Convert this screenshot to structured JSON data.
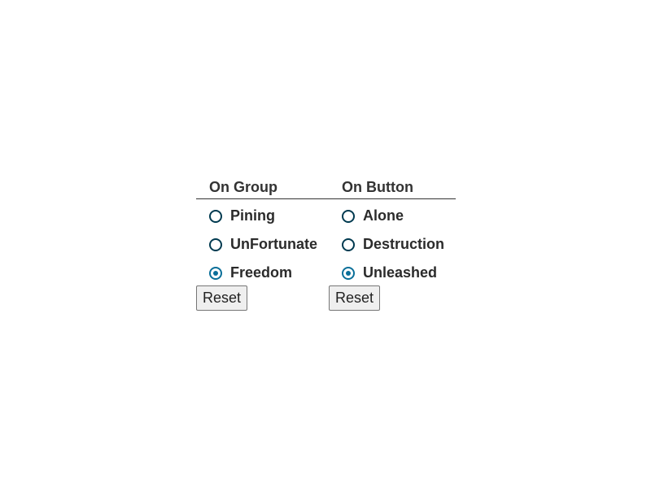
{
  "groups": [
    {
      "heading": "On Group",
      "options": [
        {
          "label": "Pining",
          "checked": false
        },
        {
          "label": "UnFortunate",
          "checked": false
        },
        {
          "label": "Freedom",
          "checked": true
        }
      ],
      "reset_label": "Reset"
    },
    {
      "heading": "On Button",
      "options": [
        {
          "label": "Alone",
          "checked": false
        },
        {
          "label": "Destruction",
          "checked": false
        },
        {
          "label": "Unleashed",
          "checked": true
        }
      ],
      "reset_label": "Reset"
    }
  ],
  "colors": {
    "radio_border": "#003a50",
    "radio_checked": "#0a6f99",
    "text": "#2b2b2b"
  }
}
